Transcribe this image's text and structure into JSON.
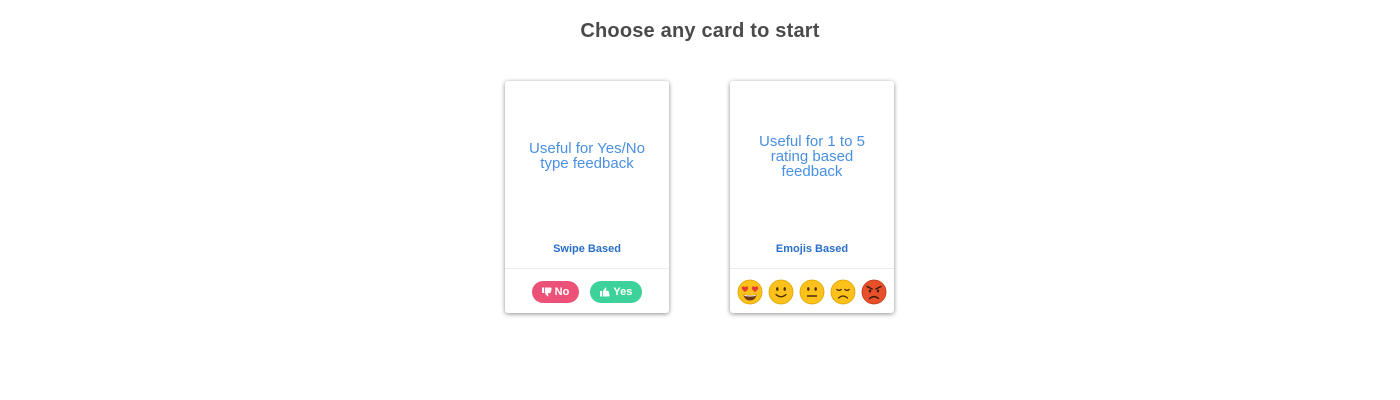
{
  "page": {
    "title": "Choose any card to start"
  },
  "cards": [
    {
      "description": "Useful for Yes/No type feedback",
      "type_label": "Swipe Based",
      "buttons": {
        "no_label": "No",
        "yes_label": "Yes"
      }
    },
    {
      "description": "Useful for 1 to 5 rating based feedback",
      "type_label": "Emojis Based",
      "emojis": [
        "heart-eyes-emoji-icon",
        "smile-emoji-icon",
        "neutral-emoji-icon",
        "disappointed-emoji-icon",
        "angry-emoji-icon"
      ]
    }
  ],
  "colors": {
    "title": "#4a4a4a",
    "description": "#4a90e2",
    "type_label": "#2a6fc9",
    "no_button": "#ec5277",
    "yes_button": "#3cd29a"
  }
}
